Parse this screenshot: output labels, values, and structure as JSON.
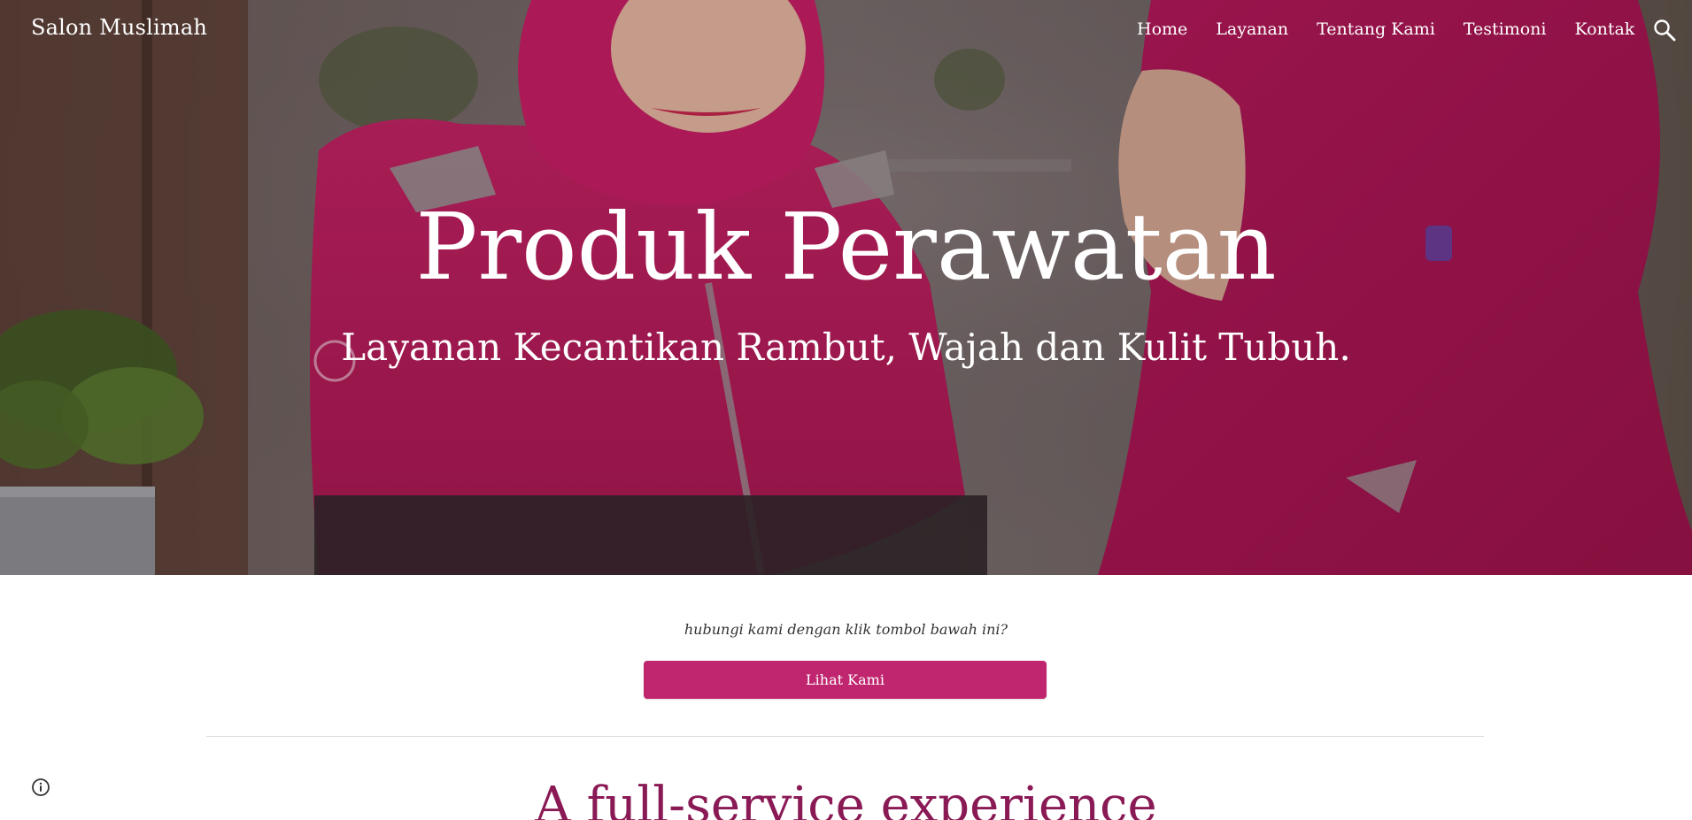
{
  "header": {
    "site_title": "Salon Muslimah"
  },
  "nav": {
    "items": [
      {
        "label": "Home"
      },
      {
        "label": "Layanan"
      },
      {
        "label": "Tentang Kami"
      },
      {
        "label": "Testimoni"
      },
      {
        "label": "Kontak"
      }
    ],
    "search_icon": "search-icon"
  },
  "hero": {
    "title": "Produk Perawatan",
    "subtitle": "Layanan Kecantikan Rambut, Wajah dan Kulit Tubuh.",
    "image_description_colors": {
      "uniform": "#c2185b",
      "background_wall": "#6b5f60"
    }
  },
  "cta": {
    "prompt": "hubungi kami dengan klik tombol bawah ini?",
    "button_label": "Lihat Kami"
  },
  "section": {
    "heading": "A full-service experience"
  },
  "colors": {
    "accent": "#c0266f",
    "heading": "#8a1a55"
  },
  "footer": {
    "info_icon": "info-icon"
  }
}
